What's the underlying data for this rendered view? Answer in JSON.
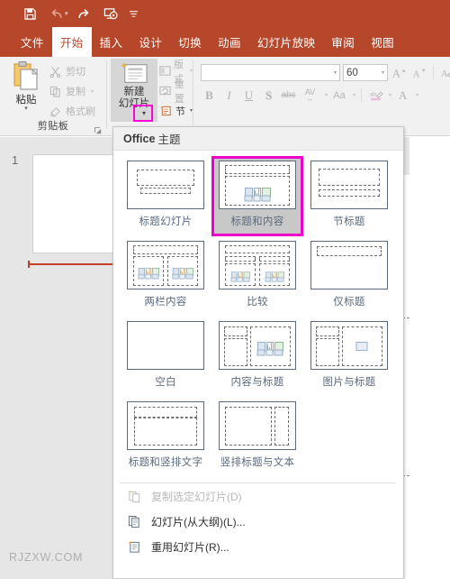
{
  "quick_access": {
    "items": [
      {
        "name": "save",
        "icon": "save-icon",
        "enabled": true
      },
      {
        "name": "undo",
        "icon": "undo-icon",
        "enabled": false
      },
      {
        "name": "redo",
        "icon": "redo-icon",
        "enabled": true
      },
      {
        "name": "start-slideshow",
        "icon": "slideshow-icon",
        "enabled": true
      },
      {
        "name": "customize",
        "icon": "chevron-down-icon",
        "enabled": true
      }
    ]
  },
  "ribbon": {
    "tabs": [
      {
        "label": "文件",
        "active": false
      },
      {
        "label": "开始",
        "active": true
      },
      {
        "label": "插入",
        "active": false
      },
      {
        "label": "设计",
        "active": false
      },
      {
        "label": "切换",
        "active": false
      },
      {
        "label": "动画",
        "active": false
      },
      {
        "label": "幻灯片放映",
        "active": false
      },
      {
        "label": "审阅",
        "active": false
      },
      {
        "label": "视图",
        "active": false
      }
    ],
    "clipboard": {
      "group_label": "剪贴板",
      "paste_label": "粘贴",
      "commands": [
        {
          "label": "剪切",
          "icon": "scissors-icon"
        },
        {
          "label": "复制",
          "icon": "copy-icon"
        },
        {
          "label": "格式刷",
          "icon": "format-painter-icon"
        }
      ]
    },
    "slides": {
      "new_slide_line1": "新建",
      "new_slide_line2": "幻灯片",
      "commands": [
        {
          "label": "版式",
          "icon": "layout-icon"
        },
        {
          "label": "重置",
          "icon": "reset-icon"
        },
        {
          "label": "节",
          "icon": "section-icon"
        }
      ]
    },
    "font": {
      "font_name": "",
      "font_size": "60",
      "buttons": [
        {
          "label": "B",
          "name": "bold-button"
        },
        {
          "label": "I",
          "name": "italic-button"
        },
        {
          "label": "U",
          "name": "underline-button"
        },
        {
          "label": "S",
          "name": "shadow-button"
        },
        {
          "label": "abc",
          "name": "strikethrough-button"
        },
        {
          "label": "AV",
          "name": "character-spacing-button"
        },
        {
          "label": "Aa",
          "name": "change-case-button"
        }
      ],
      "grow_label": "A",
      "shrink_label": "A"
    }
  },
  "slide_panel": {
    "slide_number": "1"
  },
  "watermark": "RJZXW.COM",
  "gallery": {
    "header_bold": "Office",
    "header_rest": "主题",
    "layouts": [
      {
        "label": "标题幻灯片",
        "kind": "title-slide",
        "selected": false
      },
      {
        "label": "标题和内容",
        "kind": "title-content",
        "selected": true
      },
      {
        "label": "节标题",
        "kind": "section-header",
        "selected": false
      },
      {
        "label": "两栏内容",
        "kind": "two-content",
        "selected": false
      },
      {
        "label": "比较",
        "kind": "comparison",
        "selected": false
      },
      {
        "label": "仅标题",
        "kind": "title-only",
        "selected": false
      },
      {
        "label": "空白",
        "kind": "blank",
        "selected": false
      },
      {
        "label": "内容与标题",
        "kind": "content-with-caption",
        "selected": false
      },
      {
        "label": "图片与标题",
        "kind": "picture-with-caption",
        "selected": false
      },
      {
        "label": "标题和竖排文字",
        "kind": "title-vertical-text",
        "selected": false
      },
      {
        "label": "竖排标题与文本",
        "kind": "vertical-title-text",
        "selected": false
      }
    ],
    "commands": [
      {
        "label": "复制选定幻灯片(D)",
        "accel": "D",
        "icon": "duplicate-slide-icon",
        "disabled": true
      },
      {
        "label": "幻灯片(从大纲)(L)...",
        "accel": "L",
        "icon": "slides-from-outline-icon",
        "disabled": false
      },
      {
        "label": "重用幻灯片(R)...",
        "accel": "R",
        "icon": "reuse-slides-icon",
        "disabled": false
      }
    ]
  },
  "colors": {
    "brand": "#b7472a",
    "highlight": "#ff00d4",
    "selection_bg": "#c8c8c8",
    "ribbon_bg": "#f1f1f1",
    "panel_bg": "#e6e6e6",
    "thumb_border": "#5b6a7d"
  }
}
